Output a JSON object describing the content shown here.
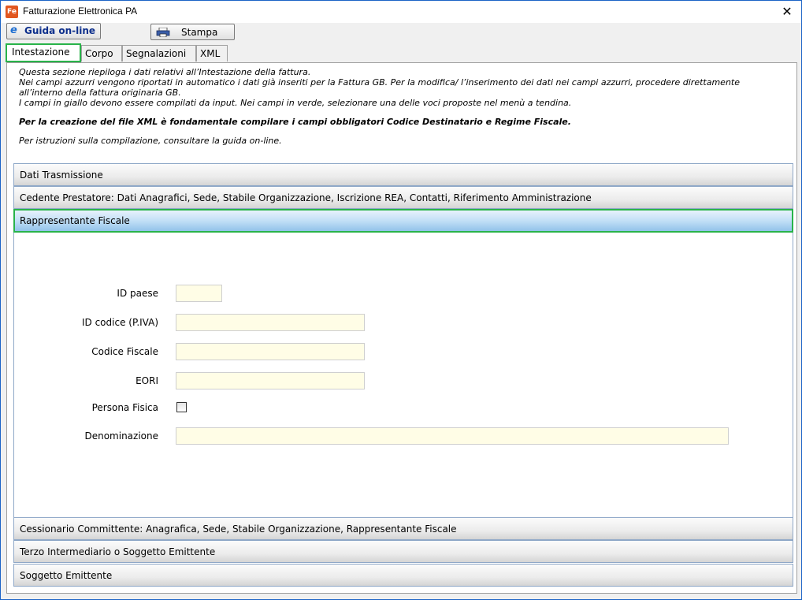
{
  "window": {
    "title": "Fatturazione Elettronica PA",
    "icon_text": "Fe",
    "close_glyph": "✕"
  },
  "toolbar": {
    "guida_label": "Guida on-line",
    "stampa_label": "Stampa"
  },
  "tabs": [
    {
      "label": "Intestazione",
      "active": true
    },
    {
      "label": "Corpo",
      "active": false
    },
    {
      "label": "Segnalazioni",
      "active": false
    },
    {
      "label": "XML",
      "active": false
    }
  ],
  "intro": {
    "line1": "Questa sezione riepiloga i dati relativi all’Intestazione della fattura.",
    "line2": "Nei campi azzurri vengono riportati in automatico i dati già inseriti per la Fattura GB. Per la modifica/ l’inserimento dei dati nei campi azzurri, procedere direttamente all’interno della fattura originaria GB.",
    "line3": "I campi in giallo devono essere compilati da input. Nei campi in verde, selezionare una delle voci proposte nel menù a tendina.",
    "bold_line": "Per la creazione del file XML è fondamentale compilare i campi obbligatori Codice Destinatario e Regime Fiscale.",
    "hint": "Per istruzioni sulla compilazione, consultare la guida on-line."
  },
  "accordion": {
    "sections": [
      {
        "label": "Dati Trasmissione"
      },
      {
        "label": "Cedente Prestatore: Dati Anagrafici, Sede, Stabile Organizzazione, Iscrizione REA, Contatti, Riferimento Amministrazione"
      },
      {
        "label": "Rappresentante Fiscale",
        "active": true
      },
      {
        "label": "Cessionario Committente: Anagrafica, Sede, Stabile Organizzazione, Rappresentante Fiscale"
      },
      {
        "label": "Terzo Intermediario o Soggetto Emittente"
      },
      {
        "label": "Soggetto Emittente"
      }
    ]
  },
  "form": {
    "id_paese": {
      "label": "ID paese",
      "value": ""
    },
    "id_codice": {
      "label": "ID codice (P.IVA)",
      "value": ""
    },
    "codice_fiscale": {
      "label": "Codice Fiscale",
      "value": ""
    },
    "eori": {
      "label": "EORI",
      "value": ""
    },
    "persona_fisica": {
      "label": "Persona Fisica",
      "checked": false
    },
    "denominazione": {
      "label": "Denominazione",
      "value": ""
    }
  },
  "colors": {
    "input_yellow": "#fffde6",
    "highlight_green": "#29b34a",
    "accordion_active_blue": "#92c3ea"
  }
}
